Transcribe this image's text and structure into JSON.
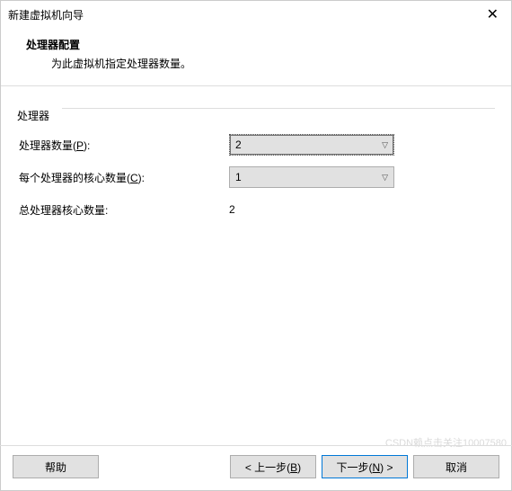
{
  "window": {
    "title": "新建虚拟机向导"
  },
  "header": {
    "title": "处理器配置",
    "subtitle": "为此虚拟机指定处理器数量。"
  },
  "group": {
    "legend": "处理器",
    "rows": {
      "proc_count": {
        "label_pre": "处理器数量(",
        "label_key": "P",
        "label_post": "):",
        "value": "2"
      },
      "cores_per": {
        "label_pre": "每个处理器的核心数量(",
        "label_key": "C",
        "label_post": "):",
        "value": "1"
      },
      "total": {
        "label": "总处理器核心数量:",
        "value": "2"
      }
    }
  },
  "footer": {
    "help": "帮助",
    "back_pre": "< 上一步(",
    "back_key": "B",
    "back_post": ")",
    "next_pre": "下一步(",
    "next_key": "N",
    "next_post": ") >",
    "cancel": "取消"
  },
  "watermark": "CSDN赖点击关注10007580"
}
